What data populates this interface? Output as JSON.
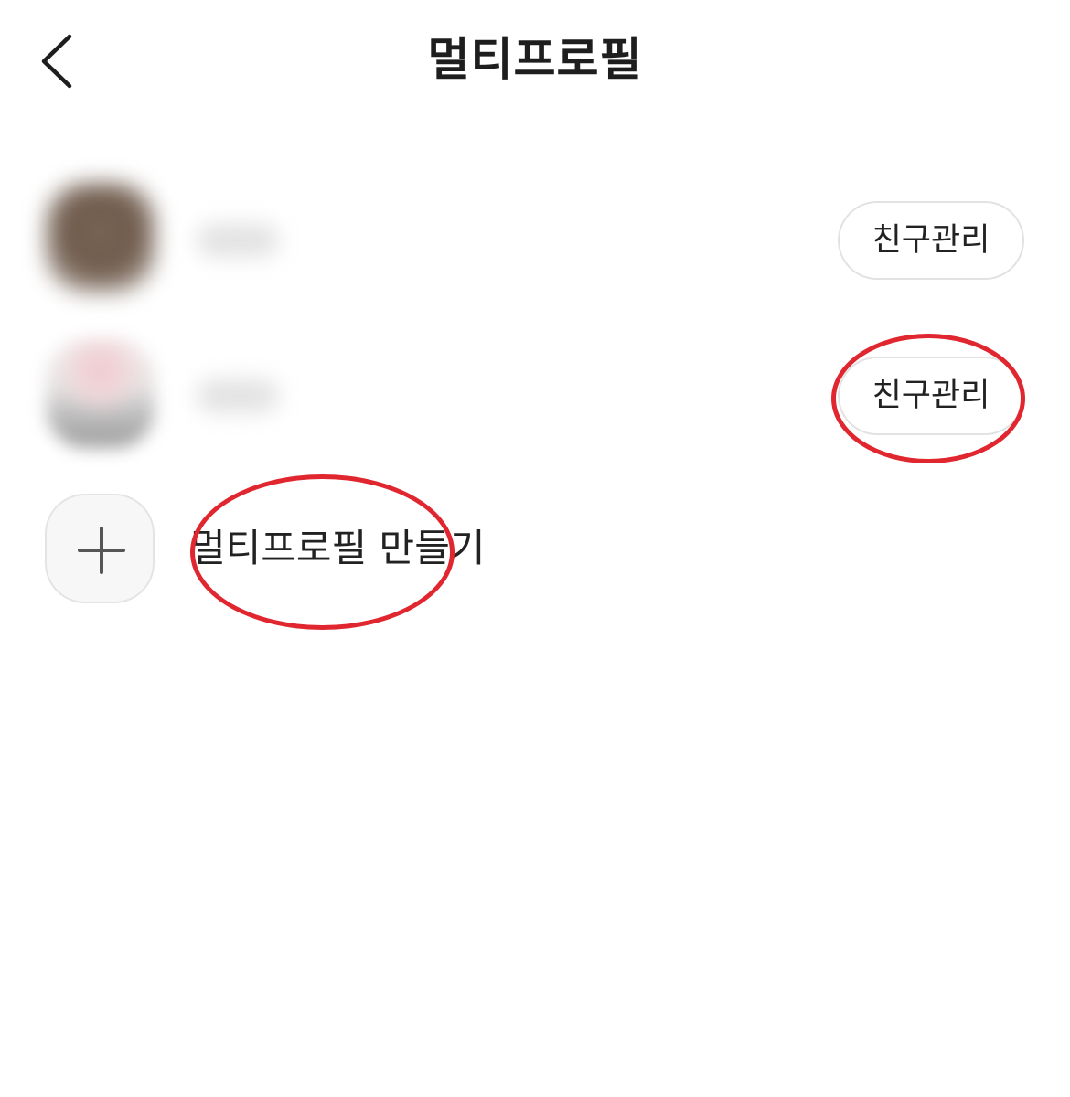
{
  "header": {
    "title": "멀티프로필",
    "back_icon": "chevron-left-icon"
  },
  "profiles": [
    {
      "manage_label": "친구관리"
    },
    {
      "manage_label": "친구관리"
    }
  ],
  "create": {
    "label": "멀티프로필 만들기",
    "icon": "plus-icon"
  },
  "annotation_color": "#e0262e"
}
